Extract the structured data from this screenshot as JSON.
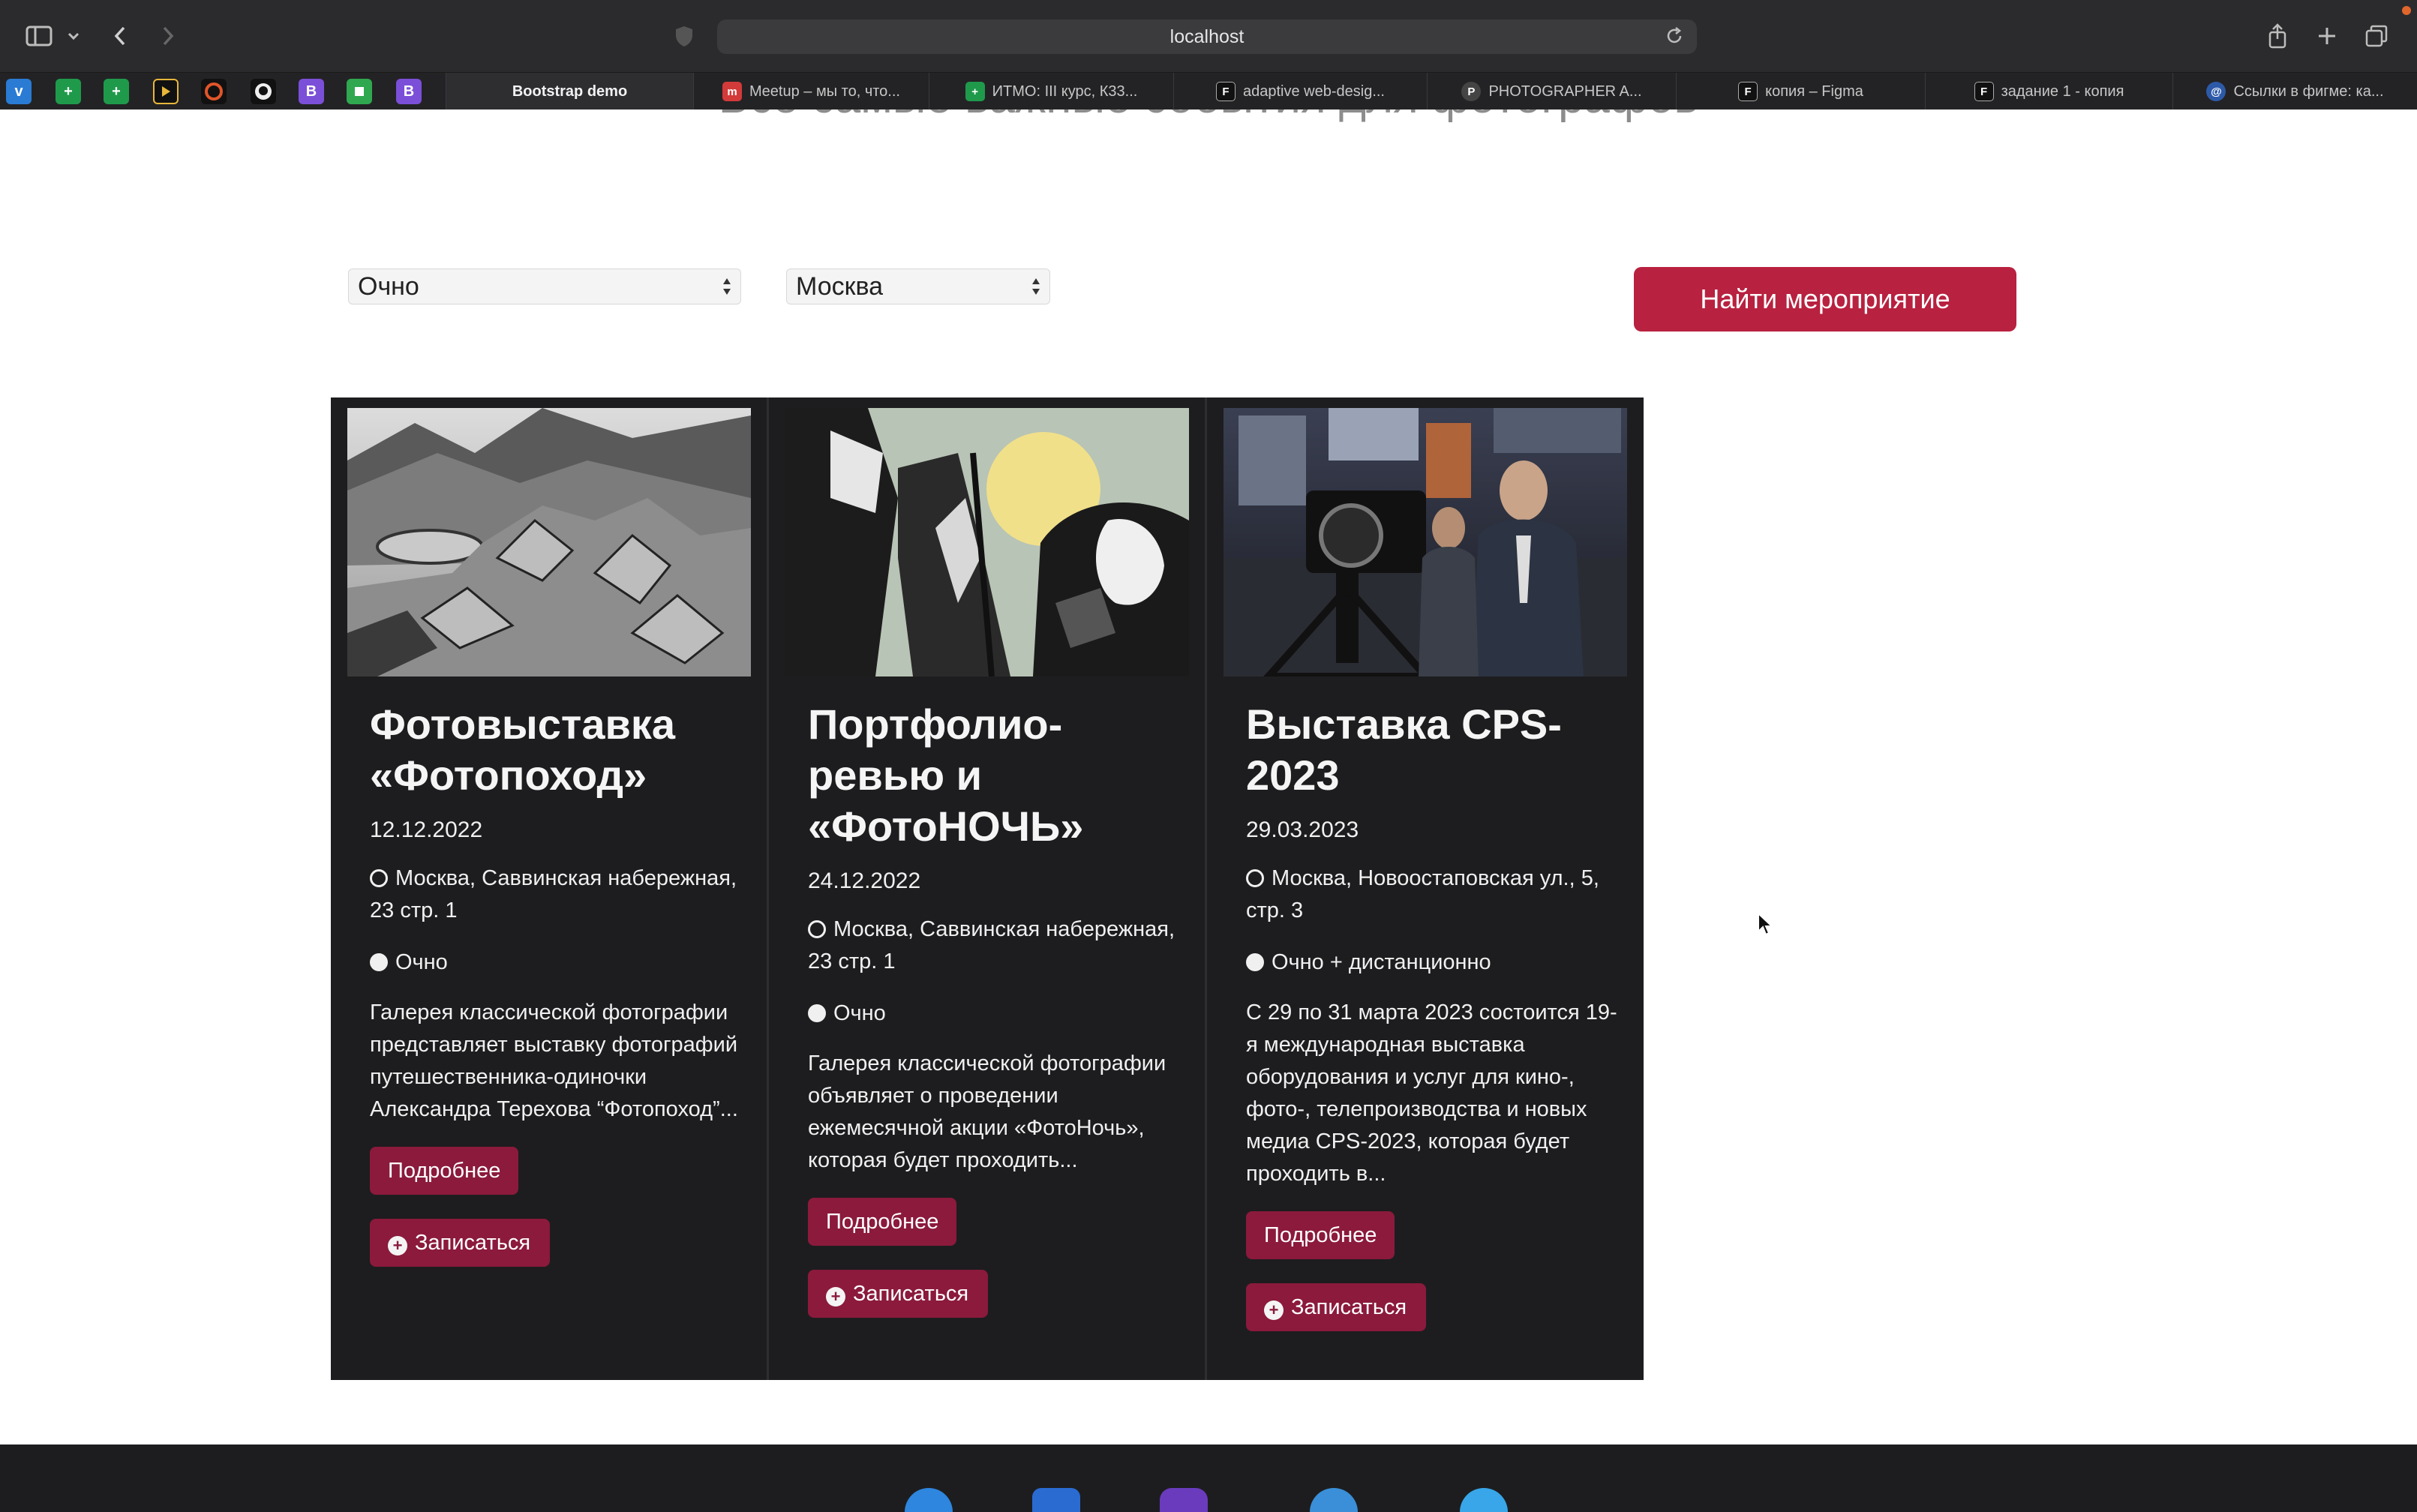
{
  "browser": {
    "url": "localhost",
    "icons": {
      "sidebar": "sidebar-icon",
      "back": "back-icon",
      "forward": "forward-icon",
      "privacy": "shield-icon",
      "reload": "reload-icon",
      "share": "share-icon",
      "new_tab": "plus-icon",
      "tab_overview": "tabs-icon"
    },
    "tabs": [
      {
        "label": "Bootstrap demo",
        "active": true
      },
      {
        "label": "Meetup – мы то, что..."
      },
      {
        "label": "ИТМО: III курс, К33..."
      },
      {
        "label": "adaptive web-desig..."
      },
      {
        "label": "PHOTOGRAPHER A..."
      },
      {
        "label": "копия – Figma"
      },
      {
        "label": "задание 1 - копия"
      },
      {
        "label": "Ссылки в фигме: ка..."
      }
    ]
  },
  "page": {
    "heading": "Все самые важные события для фотографов",
    "filters": {
      "format_value": "Очно",
      "city_value": "Москва",
      "find_button": "Найти мероприятие"
    },
    "cards": [
      {
        "title": "Фотовыставка «Фотопоход»",
        "date": "12.12.2022",
        "location": "Москва, Саввинская набережная, 23 стр. 1",
        "format": "Очно",
        "description": "Галерея классической фотографии представляет выставку фотографий путешественника-одиночки Александра Терехова “Фотопоход”...",
        "more_label": "Подробнее",
        "register_label": "Записаться"
      },
      {
        "title": "Портфолио-ревью и «ФотоНОЧЬ»",
        "date": "24.12.2022",
        "location": "Москва, Саввинская набережная, 23 стр. 1",
        "format": "Очно",
        "description": "Галерея классической фотографии объявляет о проведении ежемесячной акции «ФотоНочь», которая будет проходить...",
        "more_label": "Подробнее",
        "register_label": "Записаться"
      },
      {
        "title": "Выставка CPS-2023",
        "date": "29.03.2023",
        "location": "Москва, Новоостаповская ул., 5, стр. 3",
        "format": "Очно + дистанционно",
        "description": "С 29 по 31 марта 2023 состоится 19-я международная выставка оборудования и услуг для кино-, фото-, телепроизводства и новых медиа CPS-2023, которая будет проходить в...",
        "more_label": "Подробнее",
        "register_label": "Записаться"
      }
    ]
  },
  "colors": {
    "accent": "#b8213f",
    "card_button": "#8b1a3c",
    "card_bg": "#1d1d1f"
  }
}
